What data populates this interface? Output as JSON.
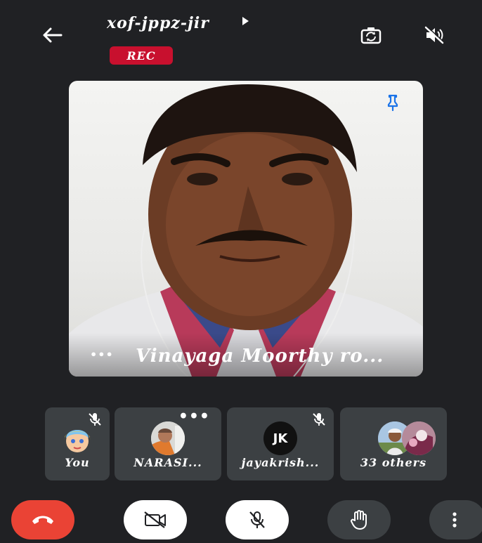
{
  "header": {
    "meeting_code": "xof-jppz-jir",
    "recording_badge": "REC",
    "icons": [
      "back-arrow-icon",
      "expand-caret-icon",
      "switch-camera-icon",
      "speaker-off-icon"
    ]
  },
  "main_tile": {
    "participant_name": "Vinayaga Moorthy ro...",
    "more_label": "•••",
    "pinned": true,
    "icons": [
      "pin-icon"
    ]
  },
  "participants": [
    {
      "label": "You",
      "muted": true
    },
    {
      "label": "NARASI...",
      "more": "•••"
    },
    {
      "label": "jayakrish...",
      "muted": true,
      "initials": "JK"
    },
    {
      "label": "33 others"
    }
  ],
  "controls": {
    "end_call_color": "#ea4335",
    "icons": [
      "end-call-icon",
      "camera-off-icon",
      "mic-off-icon",
      "raise-hand-icon",
      "more-vert-icon"
    ]
  }
}
